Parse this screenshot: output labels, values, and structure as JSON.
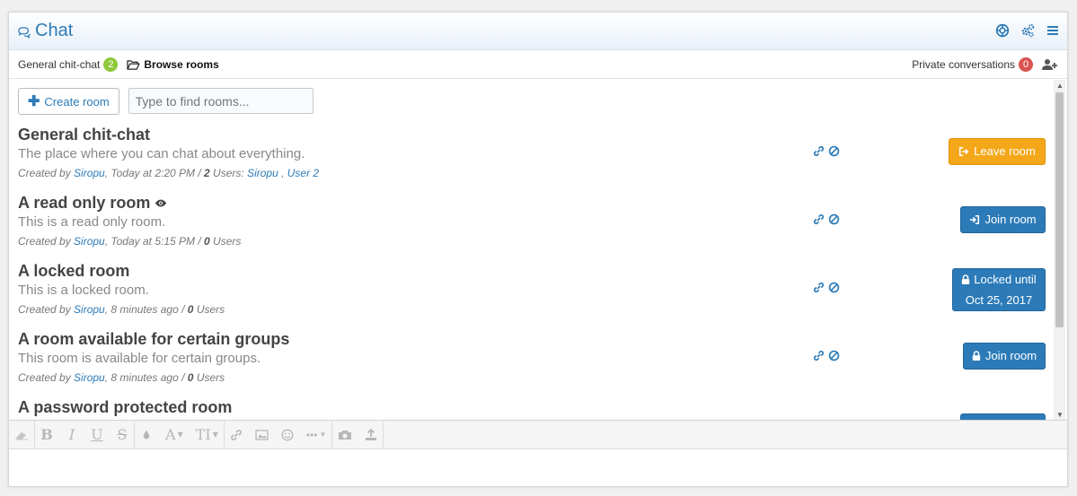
{
  "header": {
    "title": "Chat",
    "icons": [
      "life-ring-icon",
      "cogs-icon",
      "menu-icon"
    ]
  },
  "tabs": {
    "general": {
      "label": "General chit-chat",
      "count": "2"
    },
    "browse": {
      "label": "Browse rooms"
    },
    "private": {
      "label": "Private conversations",
      "count": "0"
    }
  },
  "rooms_toolbar": {
    "create_label": "Create room",
    "search_placeholder": "Type to find rooms..."
  },
  "rooms": [
    {
      "name": "General chit-chat",
      "description": "The place where you can chat about everything.",
      "created_by_prefix": "Created by",
      "creator": "Siropu",
      "when": ", Today at 2:20 PM / ",
      "users_count": "2",
      "users_label": " Users: ",
      "user_list": [
        "Siropu",
        "User 2"
      ],
      "action": "Leave room"
    },
    {
      "name": "A read only room",
      "description": "This is a read only room.",
      "created_by_prefix": "Created by",
      "creator": "Siropu",
      "when": ", Today at 5:15 PM / ",
      "users_count": "0",
      "users_label": " Users",
      "action": "Join room"
    },
    {
      "name": "A locked room",
      "description": "This is a locked room.",
      "created_by_prefix": "Created by",
      "creator": "Siropu",
      "when": ", 8 minutes ago / ",
      "users_count": "0",
      "users_label": " Users",
      "action_line1": "Locked until",
      "action_line2": "Oct 25, 2017"
    },
    {
      "name": "A room available for certain groups",
      "description": "This room is available for certain groups.",
      "created_by_prefix": "Created by",
      "creator": "Siropu",
      "when": ", 8 minutes ago / ",
      "users_count": "0",
      "users_label": " Users",
      "action": "Join room"
    },
    {
      "name": "A password protected room"
    }
  ],
  "editor": {
    "tools": [
      "eraser-icon",
      "bold",
      "italic",
      "underline",
      "strikethrough",
      "color-icon",
      "font-family",
      "font-size",
      "link-icon",
      "image-icon",
      "smiley-icon",
      "more-icon",
      "camera-icon",
      "upload-icon"
    ],
    "bold": "B",
    "italic": "I",
    "underline": "U",
    "strike": "S",
    "font": "A",
    "size": "TI"
  },
  "colors": {
    "accent": "#2c7bb8",
    "leave": "#f5a71a",
    "badge_green": "#8fc93a",
    "badge_red": "#d9534f"
  }
}
